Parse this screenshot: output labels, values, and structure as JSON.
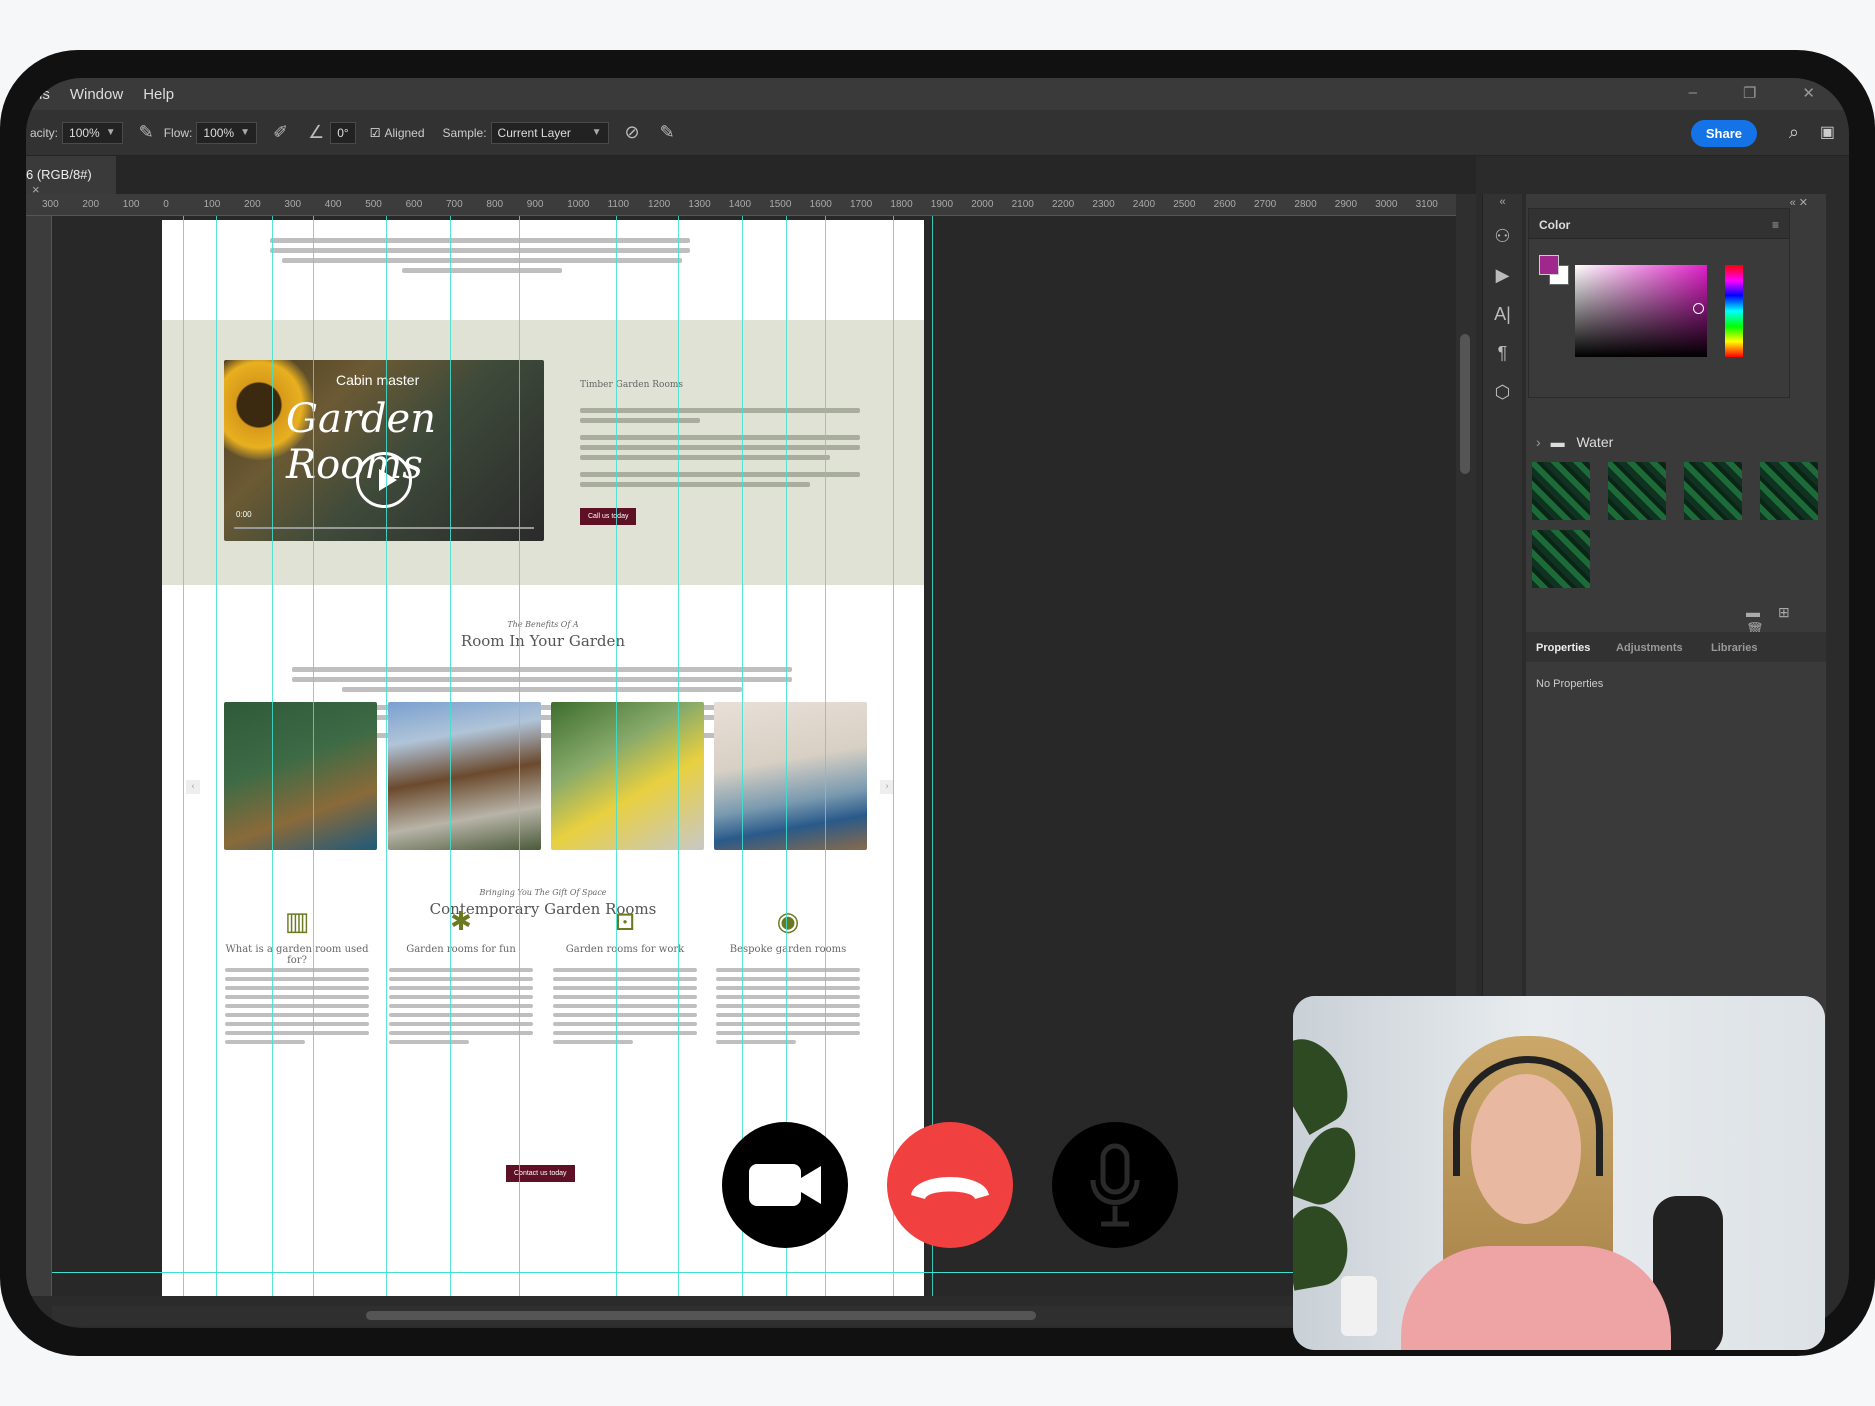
{
  "menubar": {
    "partial_item": "ns",
    "items": [
      "Window",
      "Help"
    ]
  },
  "options": {
    "opacity_label": "acity:",
    "opacity_value": "100%",
    "flow_label": "Flow:",
    "flow_value": "100%",
    "angle_value": "0°",
    "aligned_label": "Aligned",
    "sample_label": "Sample:",
    "sample_value": "Current Layer",
    "share_label": "Share"
  },
  "document_tab": {
    "title": "6 (RGB/8#)",
    "close": "×"
  },
  "ruler_ticks": [
    "300",
    "200",
    "100",
    "0",
    "100",
    "200",
    "300",
    "400",
    "500",
    "600",
    "700",
    "800",
    "900",
    "1000",
    "1100",
    "1200",
    "1300",
    "1400",
    "1500",
    "1600",
    "1700",
    "1800",
    "1900",
    "2000",
    "2100",
    "2200",
    "2300",
    "2400",
    "2500",
    "2600",
    "2700",
    "2800",
    "2900",
    "3000",
    "3100",
    "3"
  ],
  "webpage": {
    "video_brand": "Cabin master",
    "video_title": "Garden Rooms",
    "video_time": "0:00",
    "side_title": "Timber Garden Rooms",
    "cta1": "Call us today",
    "benefits_kicker": "The Benefits Of A",
    "benefits_title": "Room In Your Garden",
    "gift_kicker": "Bringing You The Gift Of Space",
    "gift_title": "Contemporary Garden Rooms",
    "features": [
      {
        "icon": "window-icon",
        "title": "What is a garden room used for?"
      },
      {
        "icon": "party-icon",
        "title": "Garden rooms for fun"
      },
      {
        "icon": "laptop-icon",
        "title": "Garden rooms for work"
      },
      {
        "icon": "tape-measure-icon",
        "title": "Bespoke garden rooms"
      }
    ],
    "cta2": "Contact us today"
  },
  "color_panel": {
    "title": "Color",
    "foreground": "#a0288c",
    "background": "#ffffff",
    "swatch_folder": "Water"
  },
  "properties_panel": {
    "tabs": [
      "Properties",
      "Adjustments",
      "Libraries"
    ],
    "active_tab": "Properties",
    "content": "No Properties"
  },
  "call_controls": {
    "camera": "camera-icon",
    "end_call": "hang-up-icon",
    "microphone": "microphone-icon",
    "end_call_color": "#f04040"
  }
}
